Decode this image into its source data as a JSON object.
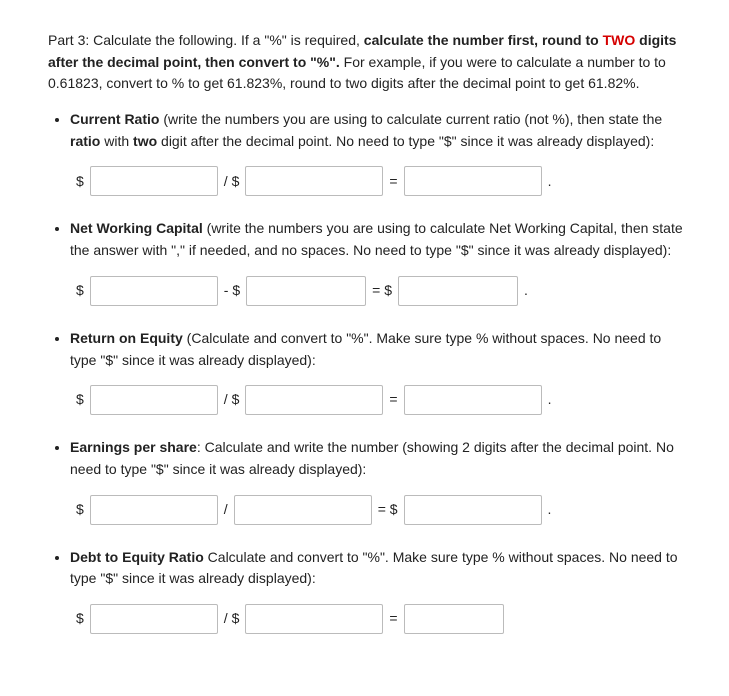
{
  "intro": {
    "part_label": "Part 3:",
    "lead": "Calculate the following. If a \"%\" is required,",
    "bold1": "calculate the number first, round to",
    "two_word": "TWO",
    "bold2": "digits after the decimal point, then convert to \"%\".",
    "tail": "For example, if you were to calculate a number to to 0.61823, convert to % to get 61.823%, round to two digits after the decimal point to get 61.82%."
  },
  "sym": {
    "dollar": "$",
    "slash_dollar": "/ $",
    "slash": "/",
    "equals": "=",
    "minus_dollar": "- $",
    "equals_dollar": "= $",
    "period": "."
  },
  "items": {
    "cr": {
      "title": "Current Ratio",
      "text_a": "(write the numbers you are using to calculate current ratio (not %), then state the",
      "title2": "ratio",
      "text_b": "with",
      "bold_mid": "two",
      "text_c": "digit after the decimal point. No need to type \"$\" since it was already displayed):"
    },
    "nwc": {
      "title": "Net Working Capital",
      "text": "(write the numbers you are using to calculate Net Working Capital, then state the answer with \",\" if needed, and no spaces. No need to type \"$\" since it was already displayed):"
    },
    "roe": {
      "title": "Return on Equity",
      "text": "(Calculate and convert to \"%\". Make sure type % without spaces. No need to type \"$\" since it was already displayed):"
    },
    "eps": {
      "title": "Earnings per share",
      "text": ": Calculate and write the number (showing 2 digits after the decimal point. No need to type \"$\" since it was already displayed):"
    },
    "de": {
      "title": "Debt to Equity Ratio",
      "text": "Calculate and convert to \"%\". Make sure type % without spaces. No need to type \"$\" since it was already displayed):"
    }
  }
}
